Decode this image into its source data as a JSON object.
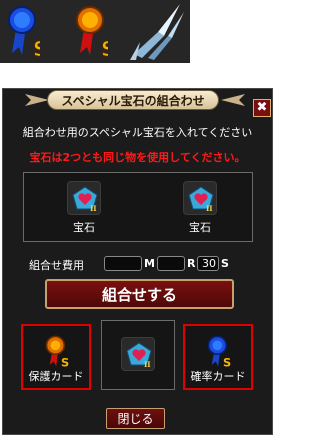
{
  "top_icons": [
    {
      "name": "protection-card-blue-medal-icon"
    },
    {
      "name": "protection-card-red-medal-icon"
    },
    {
      "name": "crystal-shard-icon"
    }
  ],
  "dialog": {
    "title": "スペシャル宝石の組合わせ",
    "close_x": "✖",
    "instruction": "組合わせ用のスペシャル宝石を入れてください",
    "warning": "宝石は2つとも同じ物を使用してください。",
    "gem_slots": [
      {
        "label": "宝石"
      },
      {
        "label": "宝石"
      }
    ],
    "cost": {
      "label": "組合せ費用",
      "m_value": "",
      "m_unit": "M",
      "r_value": "",
      "r_unit": "R",
      "s_value": "30",
      "s_unit": "S"
    },
    "combine_button": "組合せする",
    "bottom_slots": [
      {
        "label": "保護カード"
      },
      {
        "label": ""
      },
      {
        "label": "確率カード"
      }
    ],
    "close_button": "閉じる"
  },
  "colors": {
    "warning_text": "#ff1a1a",
    "highlight_border": "#e00000",
    "button_red": "#7b1010",
    "panel_bg": "#1b1b1b"
  }
}
